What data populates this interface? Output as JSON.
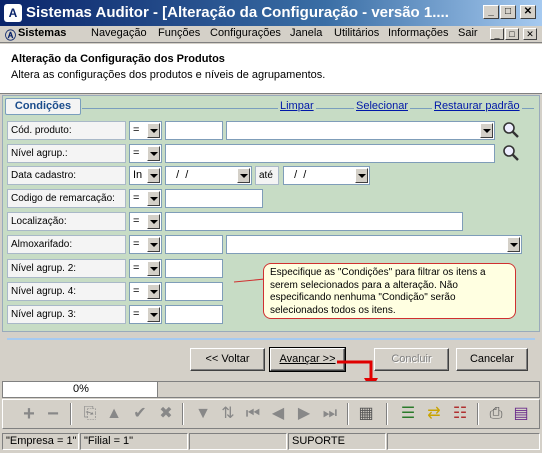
{
  "window": {
    "title": "Sistemas Auditor - [Alteração da Configuração - versão 1....",
    "minimize": "_",
    "maximize": "□",
    "close": "✕"
  },
  "menu": {
    "items": [
      "Sistemas",
      "Navegação",
      "Funções",
      "Configurações",
      "Janela",
      "Utilitários",
      "Informações",
      "Sair"
    ]
  },
  "header": {
    "title": "Alteração da Configuração dos Produtos",
    "subtitle": "Altera as configurações dos produtos e níveis de agrupamentos."
  },
  "tab": {
    "label": "Condições"
  },
  "links": {
    "clear": "Limpar",
    "select": "Selecionar",
    "restore": "Restaurar padrão"
  },
  "fields": {
    "cod_produto": {
      "label": "Cód. produto:",
      "op": "="
    },
    "nivel_agrup": {
      "label": "Nível agrup.:",
      "op": "="
    },
    "data_cadastro": {
      "label": "Data cadastro:",
      "op": "In",
      "from": "  /  /",
      "to_label": "até",
      "to": "  /  /"
    },
    "codigo_remarcacao": {
      "label": "Codigo de remarcação:",
      "op": "="
    },
    "localizacao": {
      "label": "Localização:",
      "op": "="
    },
    "almoxarifado": {
      "label": "Almoxarifado:",
      "op": "="
    },
    "nivel_agrup2": {
      "label": "Nível agrup. 2:",
      "op": "="
    },
    "nivel_agrup4": {
      "label": "Nível agrup. 4:",
      "op": "="
    },
    "nivel_agrup3": {
      "label": "Nível agrup. 3:",
      "op": "="
    }
  },
  "tooltip": {
    "text": "Especifique as \"Condições\" para filtrar os itens a serem selecionados para a alteração. Não especificando nenhuma \"Condição\" serão selecionados todos os itens."
  },
  "buttons": {
    "back": "<< Voltar",
    "next": "Avançar >>",
    "finish": "Concluir",
    "cancel": "Cancelar"
  },
  "progress": {
    "text": "0%",
    "value": 0
  },
  "status": {
    "empresa": "\"Empresa = 1\"",
    "filial": "\"Filial = 1\"",
    "user": "SUPORTE"
  },
  "colors": {
    "accent": "#0a246a",
    "form_bg": "#c7dcc5",
    "arrow": "#e00000"
  }
}
